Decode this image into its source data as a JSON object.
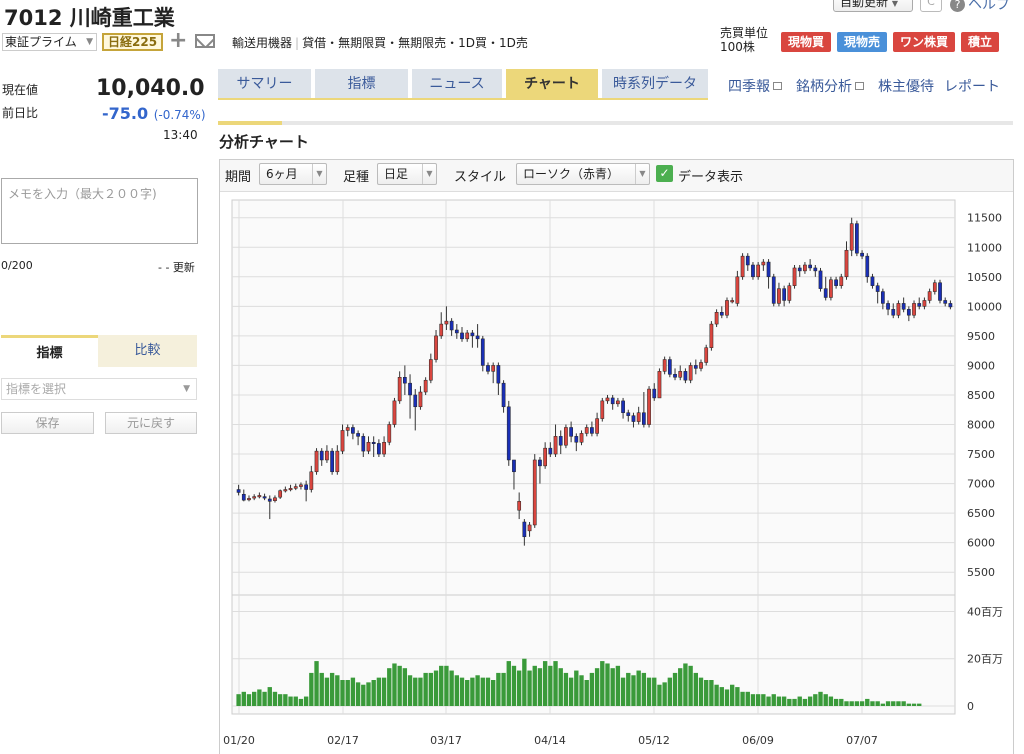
{
  "header": {
    "title": "7012 川崎重工業",
    "auto_update": "自動更新",
    "refresh": "C",
    "help": "ヘルプ",
    "market": "東証プライム",
    "index_badge": "日経225",
    "sector": "輸送用機器",
    "tags": [
      "貸借・無期限買・無期限売・1D買・1D売"
    ],
    "trade_unit_label": "売買単位",
    "trade_unit_value": "100株",
    "trade_buttons": [
      {
        "label": "現物買",
        "color": "#d9463f"
      },
      {
        "label": "現物売",
        "color": "#4a90d9"
      },
      {
        "label": "ワン株買",
        "color": "#d9463f"
      },
      {
        "label": "積立",
        "color": "#d9463f"
      }
    ]
  },
  "quote": {
    "price_label": "現在値",
    "price": "10,040.0",
    "change_label": "前日比",
    "change": "-75.0",
    "change_pct": "(-0.74%)",
    "time": "13:40"
  },
  "memo": {
    "placeholder": "メモを入力（最大２００字)",
    "count": "0/200",
    "updated": "- - 更新"
  },
  "indicator_panel": {
    "tabs": [
      "指標",
      "比較"
    ],
    "select_placeholder": "指標を選択",
    "save": "保存",
    "reset": "元に戻す"
  },
  "tabs": [
    "サマリー",
    "指標",
    "ニュース",
    "チャート",
    "時系列データ"
  ],
  "active_tab": "チャート",
  "right_links": [
    "四季報",
    "銘柄分析",
    "株主優待",
    "レポート"
  ],
  "section_title": "分析チャート",
  "chart_controls": {
    "period_label": "期間",
    "period_value": "6ヶ月",
    "foot_label": "足種",
    "foot_value": "日足",
    "style_label": "スタイル",
    "style_value": "ローソク（赤青）",
    "data_label": "データ表示"
  },
  "colors": {
    "up": "#d9463f",
    "down": "#1a2fb5",
    "volume": "#3a9a3a"
  },
  "chart_data": {
    "type": "candlestick",
    "x_ticks": [
      "01/20",
      "02/17",
      "03/17",
      "04/14",
      "05/12",
      "06/09",
      "07/07"
    ],
    "price_ticks": [
      5500,
      6000,
      6500,
      7000,
      7500,
      8000,
      8500,
      9000,
      9500,
      10000,
      10500,
      11000,
      11500
    ],
    "volume_ticks": [
      "0",
      "20百万",
      "40百万"
    ],
    "price_range": [
      5250,
      11800
    ],
    "volume_range_millions": [
      0,
      44
    ],
    "candles": [
      [
        6900,
        6850,
        6980,
        6800
      ],
      [
        6820,
        6720,
        6900,
        6700
      ],
      [
        6730,
        6750,
        6800,
        6700
      ],
      [
        6760,
        6780,
        6820,
        6720
      ],
      [
        6790,
        6800,
        6850,
        6750
      ],
      [
        6780,
        6760,
        6830,
        6720
      ],
      [
        6740,
        6700,
        6800,
        6400
      ],
      [
        6710,
        6760,
        6800,
        6680
      ],
      [
        6770,
        6880,
        6900,
        6740
      ],
      [
        6880,
        6900,
        6950,
        6850
      ],
      [
        6900,
        6920,
        6980,
        6870
      ],
      [
        6920,
        6950,
        7000,
        6890
      ],
      [
        6950,
        6980,
        7020,
        6900
      ],
      [
        6980,
        6900,
        7050,
        6700
      ],
      [
        6900,
        7200,
        7300,
        6850
      ],
      [
        7200,
        7550,
        7600,
        7150
      ],
      [
        7550,
        7400,
        7600,
        7300
      ],
      [
        7400,
        7550,
        7650,
        7350
      ],
      [
        7550,
        7200,
        7600,
        7150
      ],
      [
        7200,
        7550,
        7650,
        7150
      ],
      [
        7550,
        7900,
        8000,
        7500
      ],
      [
        7900,
        7950,
        8000,
        7800
      ],
      [
        7950,
        7850,
        8000,
        7750
      ],
      [
        7850,
        7800,
        7900,
        7650
      ],
      [
        7800,
        7550,
        7850,
        7450
      ],
      [
        7550,
        7700,
        7800,
        7500
      ],
      [
        7700,
        7680,
        7800,
        7450
      ],
      [
        7680,
        7500,
        7750,
        7450
      ],
      [
        7500,
        7700,
        7800,
        7450
      ],
      [
        7700,
        8000,
        8050,
        7650
      ],
      [
        8000,
        8400,
        8450,
        7950
      ],
      [
        8400,
        8800,
        8900,
        8350
      ],
      [
        8800,
        8700,
        9000,
        8500
      ],
      [
        8700,
        8500,
        8850,
        8100
      ],
      [
        8500,
        8300,
        8600,
        7900
      ],
      [
        8300,
        8550,
        8650,
        8250
      ],
      [
        8550,
        8750,
        8800,
        8500
      ],
      [
        8750,
        9100,
        9200,
        8700
      ],
      [
        9100,
        9500,
        9600,
        9050
      ],
      [
        9500,
        9700,
        9900,
        9450
      ],
      [
        9700,
        9750,
        10000,
        9600
      ],
      [
        9750,
        9600,
        9800,
        9500
      ],
      [
        9600,
        9550,
        9700,
        9450
      ],
      [
        9550,
        9450,
        9650,
        9400
      ],
      [
        9450,
        9550,
        9600,
        9400
      ],
      [
        9550,
        9500,
        9600,
        9300
      ],
      [
        9500,
        9450,
        9700,
        9300
      ],
      [
        9450,
        9000,
        9500,
        8900
      ],
      [
        9000,
        8900,
        9050,
        8850
      ],
      [
        8900,
        9000,
        9050,
        8700
      ],
      [
        9000,
        8700,
        9050,
        8500
      ],
      [
        8700,
        8300,
        8750,
        8200
      ],
      [
        8300,
        7400,
        8400,
        7300
      ],
      [
        7400,
        7200,
        7400,
        6900
      ],
      [
        6550,
        6700,
        6850,
        6400
      ],
      [
        6350,
        6100,
        6400,
        5950
      ],
      [
        6200,
        6300,
        6350,
        6100
      ],
      [
        6300,
        7400,
        7500,
        6250
      ],
      [
        7400,
        7300,
        7450,
        7000
      ],
      [
        7300,
        7600,
        7700,
        7250
      ],
      [
        7600,
        7500,
        7700,
        7450
      ],
      [
        7500,
        7800,
        8000,
        7450
      ],
      [
        7800,
        7650,
        7900,
        7500
      ],
      [
        7650,
        7950,
        8000,
        7600
      ],
      [
        7950,
        7800,
        8050,
        7700
      ],
      [
        7800,
        7700,
        7850,
        7550
      ],
      [
        7700,
        7850,
        7900,
        7650
      ],
      [
        7850,
        7950,
        8000,
        7800
      ],
      [
        7950,
        7850,
        8050,
        7800
      ],
      [
        7850,
        8100,
        8200,
        7800
      ],
      [
        8100,
        8400,
        8450,
        8050
      ],
      [
        8400,
        8450,
        8500,
        8350
      ],
      [
        8450,
        8350,
        8500,
        8250
      ],
      [
        8350,
        8400,
        8450,
        8300
      ],
      [
        8400,
        8200,
        8450,
        8100
      ],
      [
        8200,
        8150,
        8250,
        8050
      ],
      [
        8150,
        8050,
        8200,
        7950
      ],
      [
        8050,
        8200,
        8300,
        8000
      ],
      [
        8200,
        8000,
        8550,
        7950
      ],
      [
        8000,
        8600,
        8650,
        7950
      ],
      [
        8600,
        8450,
        8700,
        8400
      ],
      [
        8450,
        8900,
        8950,
        8450
      ],
      [
        8900,
        9100,
        9150,
        8850
      ],
      [
        9100,
        8850,
        9150,
        8800
      ],
      [
        8850,
        8800,
        8950,
        8750
      ],
      [
        8800,
        8900,
        9000,
        8750
      ],
      [
        8900,
        8750,
        8950,
        8700
      ],
      [
        8750,
        9000,
        9050,
        8700
      ],
      [
        9000,
        8950,
        9100,
        8850
      ],
      [
        8950,
        9050,
        9100,
        8900
      ],
      [
        9050,
        9300,
        9350,
        9000
      ],
      [
        9300,
        9700,
        9750,
        9250
      ],
      [
        9700,
        9900,
        9950,
        9650
      ],
      [
        9900,
        9850,
        10000,
        9800
      ],
      [
        9850,
        10100,
        10150,
        9800
      ],
      [
        10100,
        10100,
        10150,
        10050
      ],
      [
        10050,
        10500,
        10600,
        10000
      ],
      [
        10500,
        10850,
        10900,
        10450
      ],
      [
        10850,
        10700,
        10900,
        10600
      ],
      [
        10700,
        10500,
        10750,
        10450
      ],
      [
        10500,
        10700,
        10750,
        10450
      ],
      [
        10700,
        10750,
        10800,
        10600
      ],
      [
        10750,
        10500,
        10800,
        10300
      ],
      [
        10500,
        10050,
        10550,
        10000
      ],
      [
        10050,
        10300,
        10400,
        10000
      ],
      [
        10300,
        10100,
        10350,
        10000
      ],
      [
        10100,
        10350,
        10400,
        10050
      ],
      [
        10350,
        10650,
        10700,
        10300
      ],
      [
        10650,
        10600,
        10700,
        10500
      ],
      [
        10600,
        10700,
        10750,
        10550
      ],
      [
        10700,
        10650,
        10800,
        10600
      ],
      [
        10650,
        10600,
        10700,
        10500
      ],
      [
        10600,
        10300,
        10650,
        10250
      ],
      [
        10300,
        10150,
        10500,
        10100
      ],
      [
        10150,
        10450,
        10500,
        10100
      ],
      [
        10450,
        10350,
        10500,
        10300
      ],
      [
        10350,
        10500,
        10550,
        10300
      ],
      [
        10500,
        10950,
        11100,
        10450
      ],
      [
        10950,
        11400,
        11500,
        10850
      ],
      [
        11400,
        10900,
        11450,
        10850
      ],
      [
        10900,
        10850,
        10950,
        10800
      ],
      [
        10850,
        10500,
        10900,
        10400
      ],
      [
        10500,
        10350,
        10550,
        10300
      ],
      [
        10350,
        10250,
        10400,
        10050
      ],
      [
        10250,
        10050,
        10300,
        9950
      ],
      [
        10050,
        9950,
        10100,
        9850
      ],
      [
        9950,
        9850,
        10050,
        9800
      ],
      [
        9850,
        10050,
        10100,
        9800
      ],
      [
        10050,
        9950,
        10150,
        9900
      ],
      [
        9950,
        9850,
        10000,
        9750
      ],
      [
        9850,
        10050,
        10100,
        9800
      ],
      [
        10050,
        10000,
        10150,
        9950
      ],
      [
        10000,
        10100,
        10150,
        9950
      ],
      [
        10100,
        10250,
        10300,
        10050
      ],
      [
        10250,
        10400,
        10450,
        10200
      ],
      [
        10400,
        10100,
        10450,
        10050
      ],
      [
        10100,
        10050,
        10150,
        10000
      ],
      [
        10050,
        9990,
        10100,
        9950
      ]
    ],
    "volume_millions": [
      5,
      6,
      5,
      6,
      7,
      6,
      8,
      6,
      5,
      5,
      4,
      4,
      3,
      4,
      14,
      19,
      14,
      12,
      14,
      13,
      11,
      11,
      12,
      10,
      9,
      10,
      11,
      12,
      12,
      16,
      18,
      17,
      16,
      13,
      12,
      12,
      14,
      14,
      15,
      17,
      17,
      15,
      13,
      12,
      11,
      12,
      13,
      12,
      12,
      11,
      14,
      14,
      19,
      17,
      15,
      20,
      15,
      17,
      16,
      19,
      17,
      19,
      16,
      14,
      12,
      15,
      13,
      11,
      14,
      16,
      19,
      18,
      16,
      17,
      12,
      14,
      13,
      15,
      14,
      12,
      12,
      9,
      10,
      12,
      14,
      16,
      18,
      17,
      14,
      12,
      11,
      11,
      9,
      8,
      7,
      9,
      8,
      6,
      6,
      5,
      5,
      5,
      4,
      5,
      4,
      4,
      3,
      3,
      4,
      3,
      4,
      5,
      6,
      5,
      4,
      3,
      3,
      2,
      2,
      2,
      2,
      3,
      2,
      2,
      1,
      2,
      2,
      2,
      2,
      1,
      1,
      1
    ]
  }
}
